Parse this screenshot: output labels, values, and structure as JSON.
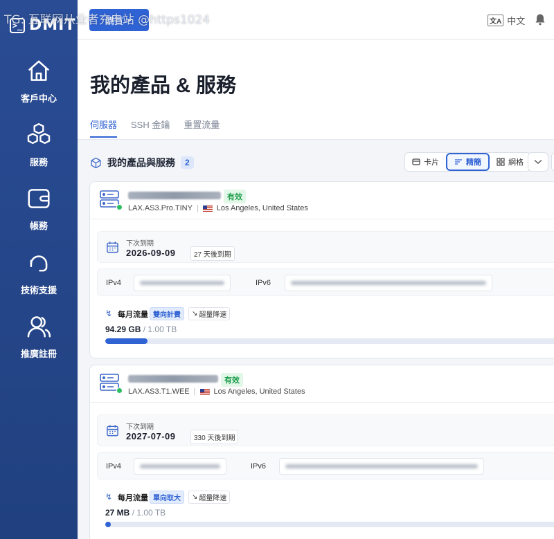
{
  "watermark": "TG: 互联网从业者充电站 @https1024",
  "app": {
    "logo_mark": ">_",
    "logo_text": "DMIT"
  },
  "sidebar": {
    "items": [
      {
        "label": "客戶中心",
        "icon": "home-icon"
      },
      {
        "label": "服務",
        "icon": "cubes-icon"
      },
      {
        "label": "帳務",
        "icon": "wallet-icon"
      },
      {
        "label": "技術支援",
        "icon": "headset-icon"
      },
      {
        "label": "推廣註冊",
        "icon": "users-icon"
      }
    ]
  },
  "topbar": {
    "dropdown_label": "購買",
    "language": "中文",
    "language_icon": "文A"
  },
  "page": {
    "title": "我的產品 & 服務",
    "tabs": [
      {
        "label": "伺服器",
        "active": true
      },
      {
        "label": "SSH 金鑰",
        "active": false
      },
      {
        "label": "重置流量",
        "active": false
      }
    ]
  },
  "section": {
    "title": "我的產品與服務",
    "count": "2",
    "views": [
      {
        "label": "卡片",
        "active": false
      },
      {
        "label": "精簡",
        "active": true
      },
      {
        "label": "網格",
        "active": false
      }
    ]
  },
  "services": [
    {
      "status": "有效",
      "plan": "LAX.AS3.Pro.TINY",
      "location": "Los Angeles, United States",
      "expiry_label": "下次到期",
      "expiry_date": "2026-09-09",
      "days_left": "27 天後到期",
      "ipv4_label": "IPv4",
      "ipv6_label": "IPv6",
      "traffic_label": "每月流量",
      "traffic_mode": "雙向計費",
      "overage": "超量降速",
      "usage": "94.29 GB",
      "total": "/ 1.00 TB",
      "usage_fraction": 0.092
    },
    {
      "status": "有效",
      "plan": "LAX.AS3.T1.WEE",
      "location": "Los Angeles, United States",
      "expiry_label": "下次到期",
      "expiry_date": "2027-07-09",
      "days_left": "330 天後到期",
      "ipv4_label": "IPv4",
      "ipv6_label": "IPv6",
      "traffic_label": "每月流量",
      "traffic_mode": "單向取大",
      "overage": "超量降速",
      "usage": "27 MB",
      "total": "/ 1.00 TB",
      "usage_fraction": 3e-05
    }
  ]
}
